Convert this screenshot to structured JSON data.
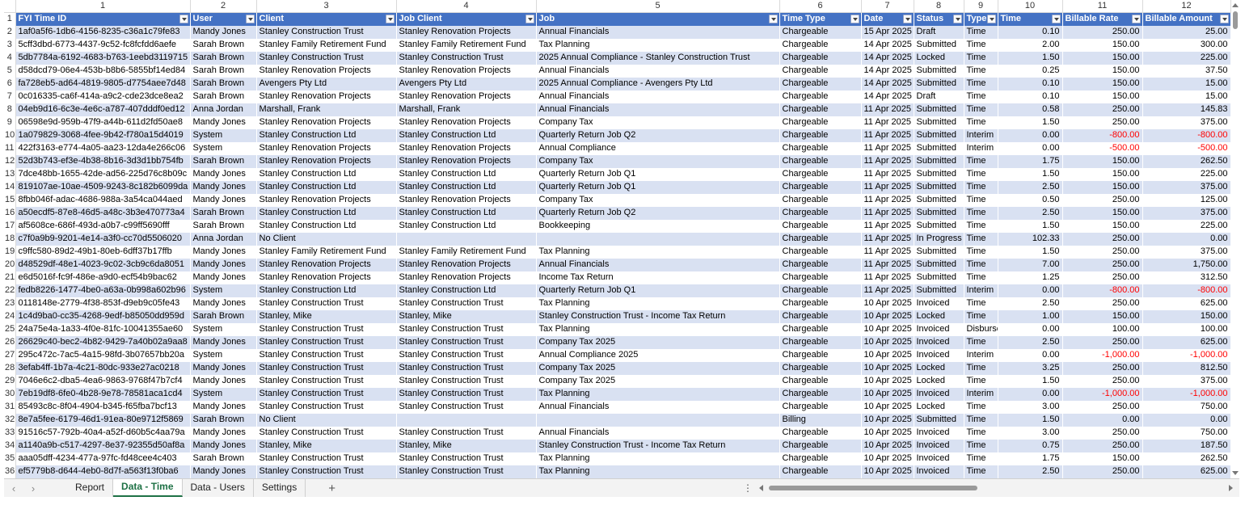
{
  "column_numbers": [
    "1",
    "2",
    "3",
    "4",
    "5",
    "6",
    "7",
    "8",
    "9",
    "10",
    "11",
    "12"
  ],
  "headers": [
    "FYI Time ID",
    "User",
    "Client",
    "Job Client",
    "Job",
    "Time Type",
    "Date",
    "Status",
    "Type",
    "Time",
    "Billable Rate",
    "Billable Amount"
  ],
  "rows": [
    {
      "num": "2",
      "cells": [
        "1af0a5f6-1db6-4156-8235-c36a1c79fe83",
        "Mandy Jones",
        "Stanley Construction Trust",
        "Stanley Renovation Projects",
        "Annual Financials",
        "Chargeable",
        "15 Apr 2025",
        "Draft",
        "Time",
        "0.10",
        "250.00",
        "25.00"
      ]
    },
    {
      "num": "3",
      "cells": [
        "5cff3dbd-6773-4437-9c52-fc8fcfdd6aefe",
        "Sarah Brown",
        "Stanley Family Retirement Fund",
        "Stanley Family Retirement Fund",
        "Tax Planning",
        "Chargeable",
        "14 Apr 2025",
        "Submitted",
        "Time",
        "2.00",
        "150.00",
        "300.00"
      ]
    },
    {
      "num": "4",
      "cells": [
        "5db7784a-6192-4683-b763-1eebd3119715",
        "Sarah Brown",
        "Stanley Construction Trust",
        "Stanley Construction Trust",
        "2025 Annual Compliance - Stanley Construction Trust",
        "Chargeable",
        "14 Apr 2025",
        "Locked",
        "Time",
        "1.50",
        "150.00",
        "225.00"
      ]
    },
    {
      "num": "5",
      "cells": [
        "d58dcd79-06e4-453b-b8b6-5855bf14ed84",
        "Sarah Brown",
        "Stanley Renovation Projects",
        "Stanley Renovation Projects",
        "Annual Financials",
        "Chargeable",
        "14 Apr 2025",
        "Submitted",
        "Time",
        "0.25",
        "150.00",
        "37.50"
      ]
    },
    {
      "num": "6",
      "cells": [
        "fa728eb5-ad64-4819-9805-d7754aee7d48",
        "Sarah Brown",
        "Avengers Pty Ltd",
        "Avengers Pty Ltd",
        "2025 Annual Compliance - Avengers Pty Ltd",
        "Chargeable",
        "14 Apr 2025",
        "Submitted",
        "Time",
        "0.10",
        "150.00",
        "15.00"
      ]
    },
    {
      "num": "7",
      "cells": [
        "0c016335-ca6f-414a-a9c2-cde23dce8ea2",
        "Sarah Brown",
        "Stanley Renovation Projects",
        "Stanley Renovation Projects",
        "Annual Financials",
        "Chargeable",
        "14 Apr 2025",
        "Draft",
        "Time",
        "0.10",
        "150.00",
        "15.00"
      ]
    },
    {
      "num": "8",
      "cells": [
        "04eb9d16-6c3e-4e6c-a787-407dddf0ed12",
        "Anna Jordan",
        "Marshall, Frank",
        "Marshall, Frank",
        "Annual Financials",
        "Chargeable",
        "11 Apr 2025",
        "Submitted",
        "Time",
        "0.58",
        "250.00",
        "145.83"
      ]
    },
    {
      "num": "9",
      "cells": [
        "06598e9d-959b-47f9-a44b-611d2fd50ae8",
        "Mandy Jones",
        "Stanley Renovation Projects",
        "Stanley Renovation Projects",
        "Company Tax",
        "Chargeable",
        "11 Apr 2025",
        "Submitted",
        "Time",
        "1.50",
        "250.00",
        "375.00"
      ]
    },
    {
      "num": "10",
      "cells": [
        "1a079829-3068-4fee-9b42-f780a15d4019",
        "System",
        "Stanley Construction Ltd",
        "Stanley Construction Ltd",
        "Quarterly Return Job Q2",
        "Chargeable",
        "11 Apr 2025",
        "Submitted",
        "Interim",
        "0.00",
        "-800.00",
        "-800.00"
      ]
    },
    {
      "num": "11",
      "cells": [
        "422f3163-e774-4a05-aa23-12da4e266c06",
        "System",
        "Stanley Renovation Projects",
        "Stanley Renovation Projects",
        "Annual Compliance",
        "Chargeable",
        "11 Apr 2025",
        "Submitted",
        "Interim",
        "0.00",
        "-500.00",
        "-500.00"
      ]
    },
    {
      "num": "12",
      "cells": [
        "52d3b743-ef3e-4b38-8b16-3d3d1bb754fb",
        "Sarah Brown",
        "Stanley Renovation Projects",
        "Stanley Renovation Projects",
        "Company Tax",
        "Chargeable",
        "11 Apr 2025",
        "Submitted",
        "Time",
        "1.75",
        "150.00",
        "262.50"
      ]
    },
    {
      "num": "13",
      "cells": [
        "7dce48bb-1655-42de-ad56-225d76c8b09c",
        "Mandy Jones",
        "Stanley Construction Ltd",
        "Stanley Construction Ltd",
        "Quarterly Return Job Q1",
        "Chargeable",
        "11 Apr 2025",
        "Submitted",
        "Time",
        "1.50",
        "150.00",
        "225.00"
      ]
    },
    {
      "num": "14",
      "cells": [
        "819107ae-10ae-4509-9243-8c182b6099da",
        "Mandy Jones",
        "Stanley Construction Ltd",
        "Stanley Construction Ltd",
        "Quarterly Return Job Q1",
        "Chargeable",
        "11 Apr 2025",
        "Submitted",
        "Time",
        "2.50",
        "150.00",
        "375.00"
      ]
    },
    {
      "num": "15",
      "cells": [
        "8fbb046f-adac-4686-988a-3a54ca044aed",
        "Mandy Jones",
        "Stanley Renovation Projects",
        "Stanley Renovation Projects",
        "Company Tax",
        "Chargeable",
        "11 Apr 2025",
        "Submitted",
        "Time",
        "0.50",
        "250.00",
        "125.00"
      ]
    },
    {
      "num": "16",
      "cells": [
        "a50ecdf5-87e8-46d5-a48c-3b3e470773a4",
        "Sarah Brown",
        "Stanley Construction Ltd",
        "Stanley Construction Ltd",
        "Quarterly Return Job Q2",
        "Chargeable",
        "11 Apr 2025",
        "Submitted",
        "Time",
        "2.50",
        "150.00",
        "375.00"
      ]
    },
    {
      "num": "17",
      "cells": [
        "af5608ce-686f-493d-a0b7-c99ff5690fff",
        "Sarah Brown",
        "Stanley Construction Ltd",
        "Stanley Construction Ltd",
        "Bookkeeping",
        "Chargeable",
        "11 Apr 2025",
        "Submitted",
        "Time",
        "1.50",
        "150.00",
        "225.00"
      ]
    },
    {
      "num": "18",
      "cells": [
        "c7f0a9b9-9201-4e14-a3f0-cc70d5506020",
        "Anna Jordan",
        "No Client",
        "",
        "",
        "Chargeable",
        "11 Apr 2025",
        "In Progress",
        "Time",
        "102.33",
        "250.00",
        "0.00"
      ]
    },
    {
      "num": "19",
      "cells": [
        "c9ffc580-89d2-49b1-80eb-6dff37b17ffb",
        "Mandy Jones",
        "Stanley Family Retirement Fund",
        "Stanley Family Retirement Fund",
        "Tax Planning",
        "Chargeable",
        "11 Apr 2025",
        "Submitted",
        "Time",
        "1.50",
        "250.00",
        "375.00"
      ]
    },
    {
      "num": "20",
      "cells": [
        "d48529df-48e1-4023-9c02-3cb9c6da8051",
        "Mandy Jones",
        "Stanley Renovation Projects",
        "Stanley Renovation Projects",
        "Annual Financials",
        "Chargeable",
        "11 Apr 2025",
        "Submitted",
        "Time",
        "7.00",
        "250.00",
        "1,750.00"
      ]
    },
    {
      "num": "21",
      "cells": [
        "e6d5016f-fc9f-486e-a9d0-ecf54b9bac62",
        "Mandy Jones",
        "Stanley Renovation Projects",
        "Stanley Renovation Projects",
        "Income Tax Return",
        "Chargeable",
        "11 Apr 2025",
        "Submitted",
        "Time",
        "1.25",
        "250.00",
        "312.50"
      ]
    },
    {
      "num": "22",
      "cells": [
        "fedb8226-1477-4be0-a63a-0b998a602b96",
        "System",
        "Stanley Construction Ltd",
        "Stanley Construction Ltd",
        "Quarterly Return Job Q1",
        "Chargeable",
        "11 Apr 2025",
        "Submitted",
        "Interim",
        "0.00",
        "-800.00",
        "-800.00"
      ]
    },
    {
      "num": "23",
      "cells": [
        "0118148e-2779-4f38-853f-d9eb9c05fe43",
        "Mandy Jones",
        "Stanley Construction Trust",
        "Stanley Construction Trust",
        "Tax Planning",
        "Chargeable",
        "10 Apr 2025",
        "Invoiced",
        "Time",
        "2.50",
        "250.00",
        "625.00"
      ]
    },
    {
      "num": "24",
      "cells": [
        "1c4d9ba0-cc35-4268-9edf-b85050dd959d",
        "Sarah Brown",
        "Stanley, Mike",
        "Stanley, Mike",
        "Stanley Construction Trust - Income Tax Return",
        "Chargeable",
        "10 Apr 2025",
        "Locked",
        "Time",
        "1.00",
        "150.00",
        "150.00"
      ]
    },
    {
      "num": "25",
      "cells": [
        "24a75e4a-1a33-4f0e-81fc-10041355ae60",
        "System",
        "Stanley Construction Trust",
        "Stanley Construction Trust",
        "Tax Planning",
        "Chargeable",
        "10 Apr 2025",
        "Invoiced",
        "Disburse",
        "0.00",
        "100.00",
        "100.00"
      ]
    },
    {
      "num": "26",
      "cells": [
        "26629c40-bec2-4b82-9429-7a40b02a9aa8",
        "Mandy Jones",
        "Stanley Construction Trust",
        "Stanley Construction Trust",
        "Company Tax  2025",
        "Chargeable",
        "10 Apr 2025",
        "Invoiced",
        "Time",
        "2.50",
        "250.00",
        "625.00"
      ]
    },
    {
      "num": "27",
      "cells": [
        "295c472c-7ac5-4a15-98fd-3b07657bb20a",
        "System",
        "Stanley Construction Trust",
        "Stanley Construction Trust",
        "Annual Compliance 2025",
        "Chargeable",
        "10 Apr 2025",
        "Invoiced",
        "Interim",
        "0.00",
        "-1,000.00",
        "-1,000.00"
      ]
    },
    {
      "num": "28",
      "cells": [
        "3efab4ff-1b7a-4c21-80dc-933e27ac0218",
        "Mandy Jones",
        "Stanley Construction Trust",
        "Stanley Construction Trust",
        "Company Tax  2025",
        "Chargeable",
        "10 Apr 2025",
        "Locked",
        "Time",
        "3.25",
        "250.00",
        "812.50"
      ]
    },
    {
      "num": "29",
      "cells": [
        "7046e6c2-dba5-4ea6-9863-9768f47b7cf4",
        "Mandy Jones",
        "Stanley Construction Trust",
        "Stanley Construction Trust",
        "Company Tax  2025",
        "Chargeable",
        "10 Apr 2025",
        "Locked",
        "Time",
        "1.50",
        "250.00",
        "375.00"
      ]
    },
    {
      "num": "30",
      "cells": [
        "7eb19df8-6fe0-4b28-9e78-78581aca1cd4",
        "System",
        "Stanley Construction Trust",
        "Stanley Construction Trust",
        "Tax Planning",
        "Chargeable",
        "10 Apr 2025",
        "Invoiced",
        "Interim",
        "0.00",
        "-1,000.00",
        "-1,000.00"
      ]
    },
    {
      "num": "31",
      "cells": [
        "85493c8c-8f04-4904-b345-f65fba7bcf13",
        "Mandy Jones",
        "Stanley Construction Trust",
        "Stanley Construction Trust",
        "Annual Financials",
        "Chargeable",
        "10 Apr 2025",
        "Locked",
        "Time",
        "3.00",
        "250.00",
        "750.00"
      ]
    },
    {
      "num": "32",
      "cells": [
        "8e7a5fee-6179-46d1-91ea-80e9712f5869",
        "Sarah Brown",
        "No Client",
        "",
        "",
        "Billing",
        "10 Apr 2025",
        "Submitted",
        "Time",
        "1.50",
        "0.00",
        "0.00"
      ]
    },
    {
      "num": "33",
      "cells": [
        "91516c57-792b-40a4-a52f-d60b5c4aa79a",
        "Mandy Jones",
        "Stanley Construction Trust",
        "Stanley Construction Trust",
        "Annual Financials",
        "Chargeable",
        "10 Apr 2025",
        "Invoiced",
        "Time",
        "3.00",
        "250.00",
        "750.00"
      ]
    },
    {
      "num": "34",
      "cells": [
        "a1140a9b-c517-4297-8e37-92355d50af8a",
        "Mandy Jones",
        "Stanley, Mike",
        "Stanley, Mike",
        "Stanley Construction Trust - Income Tax Return",
        "Chargeable",
        "10 Apr 2025",
        "Invoiced",
        "Time",
        "0.75",
        "250.00",
        "187.50"
      ]
    },
    {
      "num": "35",
      "cells": [
        "aaa05dff-4234-477a-97fc-fd48cee4c403",
        "Sarah Brown",
        "Stanley Construction Trust",
        "Stanley Construction Trust",
        "Tax Planning",
        "Chargeable",
        "10 Apr 2025",
        "Invoiced",
        "Time",
        "1.75",
        "150.00",
        "262.50"
      ]
    },
    {
      "num": "36",
      "cells": [
        "ef5779b8-d644-4eb0-8d7f-a563f13f0ba6",
        "Mandy Jones",
        "Stanley Construction Trust",
        "Stanley Construction Trust",
        "Tax Planning",
        "Chargeable",
        "10 Apr 2025",
        "Invoiced",
        "Time",
        "2.50",
        "250.00",
        "625.00"
      ]
    }
  ],
  "sheet_tabs": [
    {
      "label": "Report",
      "active": false
    },
    {
      "label": "Data - Time",
      "active": true
    },
    {
      "label": "Data - Users",
      "active": false
    },
    {
      "label": "Settings",
      "active": false
    }
  ],
  "tabbar": {
    "add_sheet_icon": "plus-icon",
    "prev_icon": "chevron-left-icon",
    "next_icon": "chevron-right-icon",
    "more_icon": "more-dots-icon"
  },
  "colors": {
    "header_bg": "#4472c4",
    "band_bg": "#d9e1f2",
    "negative": "#ff0000",
    "active_tab": "#1e7145"
  }
}
